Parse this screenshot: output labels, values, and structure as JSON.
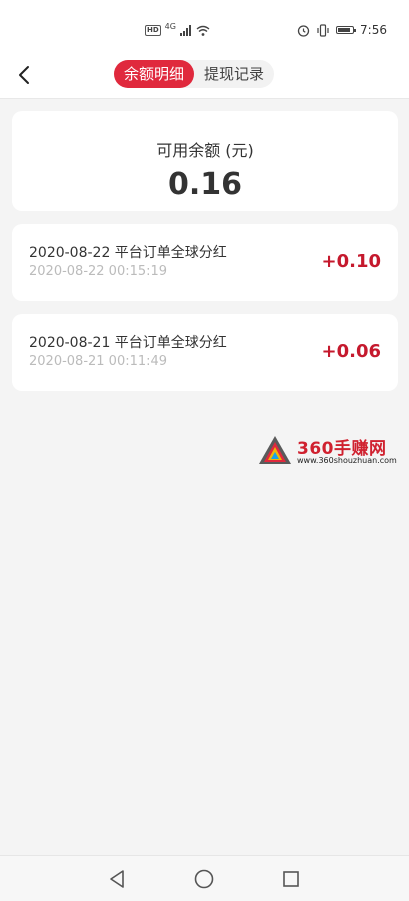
{
  "status_bar": {
    "network": "4G",
    "time": "7:56"
  },
  "header": {
    "tabs": [
      {
        "label": "余额明细",
        "active": true
      },
      {
        "label": "提现记录",
        "active": false
      }
    ],
    "accent_color": "#e0293d"
  },
  "balance": {
    "label": "可用余额 (元)",
    "value": "0.16"
  },
  "records": [
    {
      "title": "2020-08-22 平台订单全球分红",
      "time": "2020-08-22 00:15:19",
      "amount": "+0.10"
    },
    {
      "title": "2020-08-21 平台订单全球分红",
      "time": "2020-08-21 00:11:49",
      "amount": "+0.06"
    }
  ],
  "watermark": {
    "title": "360手赚网",
    "url": "www.360shouzhuan.com"
  },
  "nav_bar": {
    "icons": [
      "back-triangle-icon",
      "home-circle-icon",
      "recents-square-icon"
    ]
  }
}
